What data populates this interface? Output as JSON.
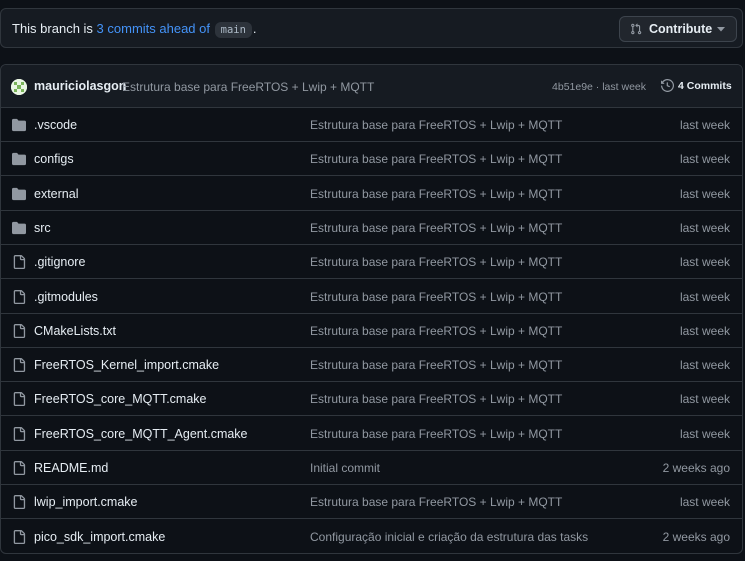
{
  "banner": {
    "text_before": "This branch is ",
    "link_text": "3 commits ahead of",
    "branch": "main",
    "text_after": ".",
    "contribute_label": "Contribute"
  },
  "commit": {
    "author": "mauriciolasgon",
    "message": "Estrutura base para FreeRTOS + Lwip + MQTT",
    "meta": "4b51e9e · last week",
    "commits_label": "4 Commits"
  },
  "files": [
    {
      "type": "folder",
      "name": ".vscode",
      "message": "Estrutura base para FreeRTOS + Lwip + MQTT",
      "date": "last week"
    },
    {
      "type": "folder",
      "name": "configs",
      "message": "Estrutura base para FreeRTOS + Lwip + MQTT",
      "date": "last week"
    },
    {
      "type": "folder",
      "name": "external",
      "message": "Estrutura base para FreeRTOS + Lwip + MQTT",
      "date": "last week"
    },
    {
      "type": "folder",
      "name": "src",
      "message": "Estrutura base para FreeRTOS + Lwip + MQTT",
      "date": "last week"
    },
    {
      "type": "file",
      "name": ".gitignore",
      "message": "Estrutura base para FreeRTOS + Lwip + MQTT",
      "date": "last week"
    },
    {
      "type": "file",
      "name": ".gitmodules",
      "message": "Estrutura base para FreeRTOS + Lwip + MQTT",
      "date": "last week"
    },
    {
      "type": "file",
      "name": "CMakeLists.txt",
      "message": "Estrutura base para FreeRTOS + Lwip + MQTT",
      "date": "last week"
    },
    {
      "type": "file",
      "name": "FreeRTOS_Kernel_import.cmake",
      "message": "Estrutura base para FreeRTOS + Lwip + MQTT",
      "date": "last week"
    },
    {
      "type": "file",
      "name": "FreeRTOS_core_MQTT.cmake",
      "message": "Estrutura base para FreeRTOS + Lwip + MQTT",
      "date": "last week"
    },
    {
      "type": "file",
      "name": "FreeRTOS_core_MQTT_Agent.cmake",
      "message": "Estrutura base para FreeRTOS + Lwip + MQTT",
      "date": "last week"
    },
    {
      "type": "file",
      "name": "README.md",
      "message": "Initial commit",
      "date": "2 weeks ago"
    },
    {
      "type": "file",
      "name": "lwip_import.cmake",
      "message": "Estrutura base para FreeRTOS + Lwip + MQTT",
      "date": "last week"
    },
    {
      "type": "file",
      "name": "pico_sdk_import.cmake",
      "message": "Configuração inicial e criação da estrutura das tasks",
      "date": "2 weeks ago"
    }
  ],
  "colors": {
    "background": "#0d1117",
    "header_bg": "#161b22",
    "border": "#30363d",
    "link": "#4493f8",
    "muted": "#9198a1",
    "text": "#e6edf3"
  }
}
